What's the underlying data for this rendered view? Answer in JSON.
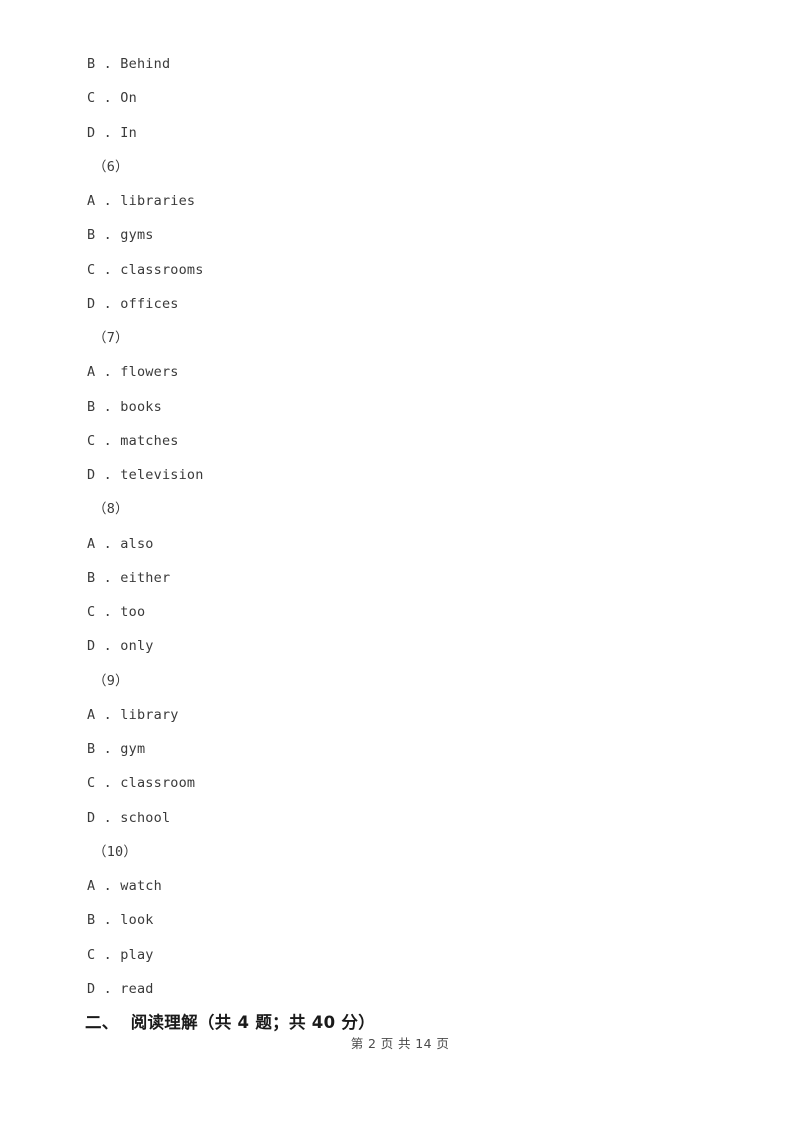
{
  "document": {
    "background_color": "#ffffff",
    "body_text_color": "#3a3a3a",
    "heading_text_color": "#1a1a1a"
  },
  "lines": [
    {
      "kind": "option",
      "text": "B . Behind"
    },
    {
      "kind": "option",
      "text": "C . On"
    },
    {
      "kind": "option",
      "text": "D . In"
    },
    {
      "kind": "qnum",
      "text": "（6）"
    },
    {
      "kind": "option",
      "text": "A . libraries"
    },
    {
      "kind": "option",
      "text": "B . gyms"
    },
    {
      "kind": "option",
      "text": "C . classrooms"
    },
    {
      "kind": "option",
      "text": "D . offices"
    },
    {
      "kind": "qnum",
      "text": "（7）"
    },
    {
      "kind": "option",
      "text": "A . flowers"
    },
    {
      "kind": "option",
      "text": "B . books"
    },
    {
      "kind": "option",
      "text": "C . matches"
    },
    {
      "kind": "option",
      "text": "D . television"
    },
    {
      "kind": "qnum",
      "text": "（8）"
    },
    {
      "kind": "option",
      "text": "A . also"
    },
    {
      "kind": "option",
      "text": "B . either"
    },
    {
      "kind": "option",
      "text": "C . too"
    },
    {
      "kind": "option",
      "text": "D . only"
    },
    {
      "kind": "qnum",
      "text": "（9）"
    },
    {
      "kind": "option",
      "text": "A . library"
    },
    {
      "kind": "option",
      "text": "B . gym"
    },
    {
      "kind": "option",
      "text": "C . classroom"
    },
    {
      "kind": "option",
      "text": "D . school"
    },
    {
      "kind": "qnum",
      "text": "（10）"
    },
    {
      "kind": "option",
      "text": "A . watch"
    },
    {
      "kind": "option",
      "text": "B . look"
    },
    {
      "kind": "option",
      "text": "C . play"
    },
    {
      "kind": "option",
      "text": "D . read"
    }
  ],
  "section_heading": {
    "text": "二、  阅读理解（共 4 题；共 40 分）",
    "number": "二、",
    "title": "阅读理解",
    "score_note": "（共 4 题；共 40 分）"
  },
  "footer": {
    "text": "第 2 页 共 14 页",
    "current_page": "2",
    "total_pages": "14"
  }
}
